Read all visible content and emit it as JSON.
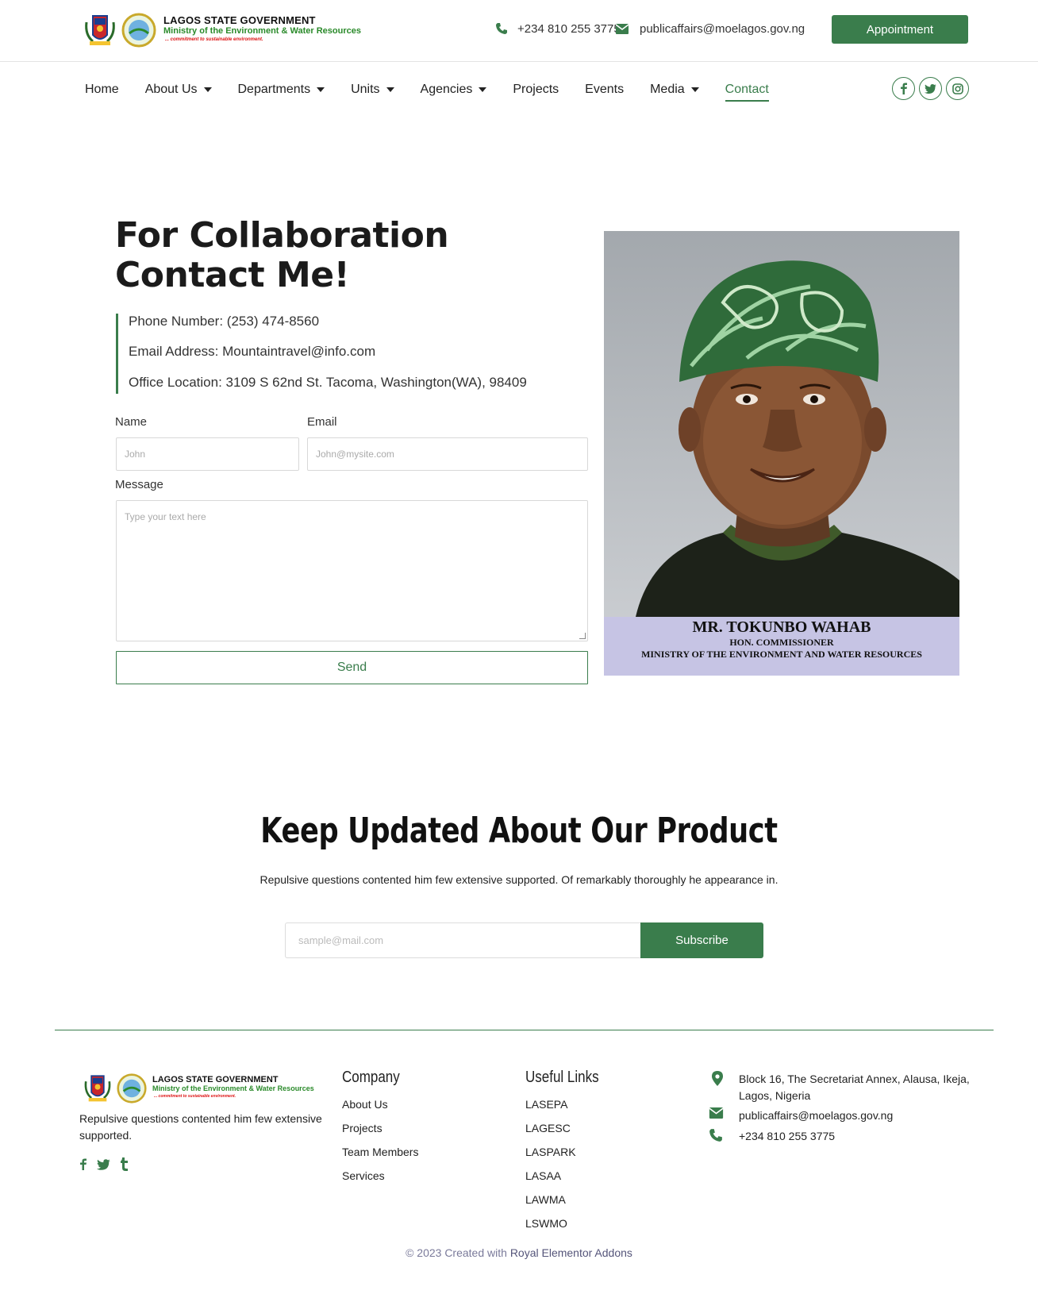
{
  "header": {
    "logo": {
      "line1": "LAGOS STATE GOVERNMENT",
      "line2": "Ministry of the Environment & Water Resources",
      "tagline": "... commitment to sustainable environment."
    },
    "phone": "+234 810 255 3775",
    "email": "publicaffairs@moelagos.gov.ng",
    "appointment_label": "Appointment"
  },
  "nav": {
    "items": [
      {
        "label": "Home"
      },
      {
        "label": "About Us"
      },
      {
        "label": "Departments"
      },
      {
        "label": "Units"
      },
      {
        "label": "Agencies"
      },
      {
        "label": "Projects"
      },
      {
        "label": "Events"
      },
      {
        "label": "Media"
      },
      {
        "label": "Contact"
      }
    ],
    "socials": [
      "facebook-icon",
      "twitter-icon",
      "instagram-icon"
    ]
  },
  "contact_section": {
    "title_line1": "For Collaboration",
    "title_line2": "Contact Me!",
    "phone": "Phone Number: (253) 474-8560",
    "email": "Email Address: Mountaintravel@info.com",
    "location": "Office Location: 3109 S 62nd St. Tacoma, Washington(WA), 98409",
    "form": {
      "name_label": "Name",
      "name_placeholder": "John",
      "email_label": "Email",
      "email_placeholder": "John@mysite.com",
      "message_label": "Message",
      "message_placeholder": "Type your text here",
      "send_label": "Send"
    },
    "portrait": {
      "name": "MR. TOKUNBO WAHAB",
      "role": "HON. COMMISSIONER",
      "ministry": "MINISTRY OF THE ENVIRONMENT AND WATER RESOURCES"
    }
  },
  "newsletter": {
    "title": "Keep Updated About Our Product",
    "subtitle": "Repulsive questions contented him few extensive supported. Of remarkably thoroughly he appearance in.",
    "placeholder": "sample@mail.com",
    "button": "Subscribe"
  },
  "footer": {
    "about": "Repulsive questions contented him few extensive supported.",
    "company_title": "Company",
    "company_links": [
      "About Us",
      "Projects",
      "Team Members",
      "Services"
    ],
    "useful_title": "Useful Links",
    "useful_links": [
      "LASEPA",
      "LAGESC",
      "LASPARK",
      "LASAA",
      "LAWMA",
      "LSWMO"
    ],
    "address": "Block 16, The Secretariat Annex, Alausa, Ikeja, Lagos, Nigeria",
    "email": "publicaffairs@moelagos.gov.ng",
    "phone": "+234 810 255 3775",
    "copyright_prefix": "© 2023 Created with",
    "copyright_link": "Royal Elementor Addons"
  },
  "colors": {
    "accent": "#3a7d4c",
    "text": "#222222"
  }
}
